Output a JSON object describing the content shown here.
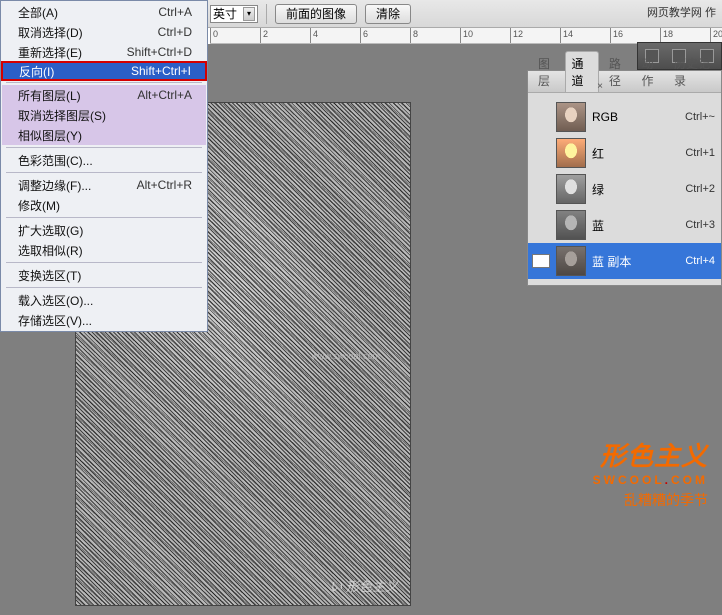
{
  "toolbar": {
    "unit": "英寸",
    "btn_front_image": "前面的图像",
    "btn_clear": "清除",
    "brand_text": "网页教学网 作"
  },
  "ruler_ticks": [
    "0",
    "2",
    "4",
    "6",
    "8",
    "10",
    "12",
    "14",
    "16",
    "18",
    "20"
  ],
  "menu": {
    "all": {
      "label": "全部(A)",
      "shortcut": "Ctrl+A"
    },
    "deselect": {
      "label": "取消选择(D)",
      "shortcut": "Ctrl+D"
    },
    "reselect": {
      "label": "重新选择(E)",
      "shortcut": "Shift+Ctrl+D"
    },
    "inverse": {
      "label": "反向(I)",
      "shortcut": "Shift+Ctrl+I"
    },
    "all_layers": {
      "label": "所有图层(L)",
      "shortcut": "Alt+Ctrl+A"
    },
    "deselect_layers": {
      "label": "取消选择图层(S)",
      "shortcut": ""
    },
    "similar_layers": {
      "label": "相似图层(Y)",
      "shortcut": ""
    },
    "color_range": {
      "label": "色彩范围(C)...",
      "shortcut": ""
    },
    "refine_edge": {
      "label": "调整边缘(F)...",
      "shortcut": "Alt+Ctrl+R"
    },
    "modify": {
      "label": "修改(M)",
      "shortcut": ""
    },
    "grow": {
      "label": "扩大选取(G)",
      "shortcut": ""
    },
    "similar": {
      "label": "选取相似(R)",
      "shortcut": ""
    },
    "transform": {
      "label": "变换选区(T)",
      "shortcut": ""
    },
    "load": {
      "label": "载入选区(O)...",
      "shortcut": ""
    },
    "save": {
      "label": "存储选区(V)...",
      "shortcut": ""
    }
  },
  "panel": {
    "tabs": {
      "layers": "图层",
      "channels": "通道",
      "paths": "路径",
      "actions": "动作",
      "history": "历史记录"
    },
    "channels": [
      {
        "name": "RGB",
        "shortcut": "Ctrl+~",
        "thumb": "rgb",
        "eye": false,
        "sel": false
      },
      {
        "name": "红",
        "shortcut": "Ctrl+1",
        "thumb": "r",
        "eye": false,
        "sel": false
      },
      {
        "name": "绿",
        "shortcut": "Ctrl+2",
        "thumb": "g",
        "eye": false,
        "sel": false
      },
      {
        "name": "蓝",
        "shortcut": "Ctrl+3",
        "thumb": "b",
        "eye": false,
        "sel": false
      },
      {
        "name": "蓝 副本",
        "shortcut": "Ctrl+4",
        "thumb": "bc",
        "eye": true,
        "sel": true
      }
    ]
  },
  "canvas": {
    "sketch_label": "www.swcool.com",
    "signature": "い 形色主义"
  },
  "watermark": {
    "line1": "形色主义",
    "line2_a": "SWCOOL",
    "line2_b": "COM",
    "line3": "乱糟糟的季节"
  }
}
